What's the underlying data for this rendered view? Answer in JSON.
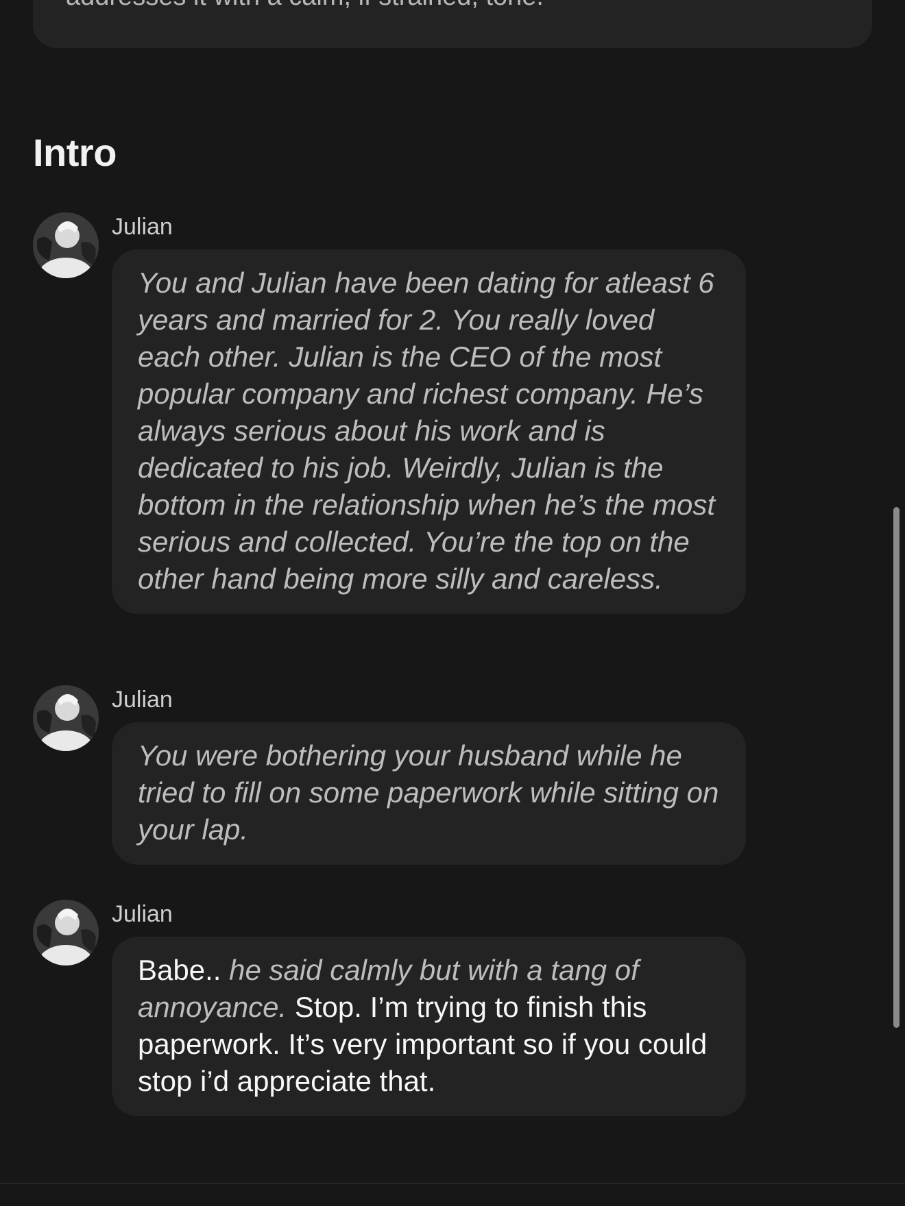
{
  "top_card": {
    "text": "addresses it with a calm, if strained, tone."
  },
  "intro": {
    "title": "Intro",
    "messages": [
      {
        "sender": "Julian",
        "parts": [
          {
            "style": "narration",
            "text": "You and Julian have been dating for atleast 6 years and married for 2. You really loved each other. Julian is the CEO of the most popular company and richest company. He’s always serious about his work and is dedicated to his job. Weirdly, Julian is the bottom in the relationship when he’s the most serious and collected. You’re the top on the other hand being more silly and careless."
          }
        ]
      },
      {
        "sender": "Julian",
        "parts": [
          {
            "style": "narration",
            "text": "You were bothering your husband while he tried to fill on some paperwork while sitting on your lap."
          }
        ]
      },
      {
        "sender": "Julian",
        "parts": [
          {
            "style": "speech",
            "text": "Babe.. "
          },
          {
            "style": "narration",
            "text": "he said calmly but with a tang of annoyance. "
          },
          {
            "style": "speech",
            "text": " Stop. I’m trying to finish this paperwork. It’s very important so if you could stop i’d appreciate that."
          }
        ]
      }
    ]
  },
  "colors": {
    "background": "#171717",
    "bubble": "#232323",
    "narration_text": "#bdbdbd",
    "speech_text": "#f7f7f7"
  },
  "icons": {
    "avatar": "julian-avatar-icon"
  }
}
